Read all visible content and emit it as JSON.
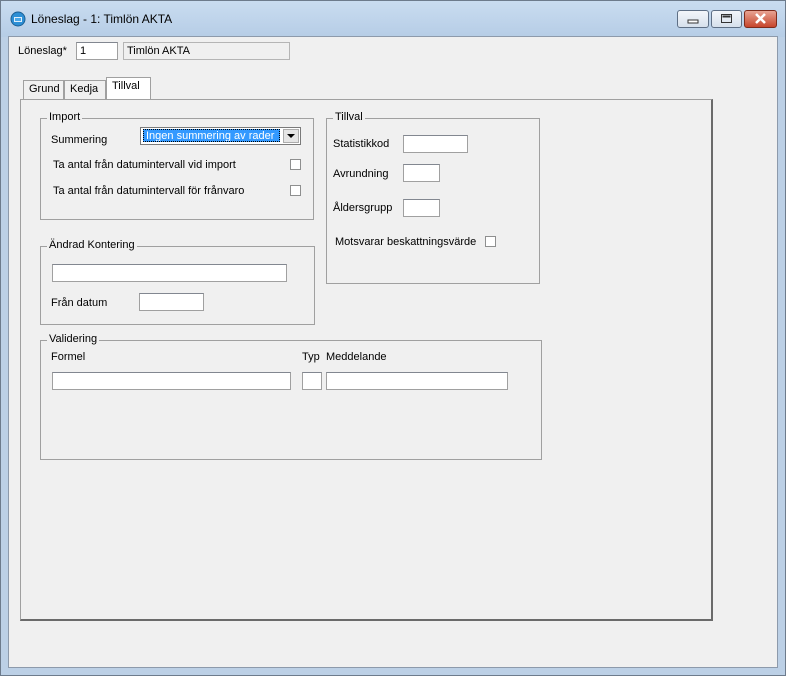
{
  "window": {
    "title": "Löneslag - 1: Timlön AKTA",
    "icon": "app-icon",
    "controls": [
      "minimize-icon",
      "maximize-icon",
      "close-icon"
    ]
  },
  "header": {
    "loneslag_label": "Löneslag*",
    "loneslag_value": "1",
    "name_value": "Timlön AKTA"
  },
  "tabs": [
    {
      "label": "Grund",
      "active": false
    },
    {
      "label": "Kedja",
      "active": false
    },
    {
      "label": "Tillval",
      "active": true
    }
  ],
  "import_group": {
    "legend": "Import",
    "summering_label": "Summering",
    "summering_value": "Ingen summering av rader",
    "checkbox1_label": "Ta antal från datumintervall vid import",
    "checkbox1_checked": false,
    "checkbox2_label": "Ta antal från datumintervall för frånvaro",
    "checkbox2_checked": false
  },
  "tillval_group": {
    "legend": "Tillval",
    "statistikkod_label": "Statistikkod",
    "statistikkod_value": "",
    "avrundning_label": "Avrundning",
    "avrundning_value": "",
    "aldersgrupp_label": "Åldersgrupp",
    "aldersgrupp_value": "",
    "beskattning_label": "Motsvarar beskattningsvärde",
    "beskattning_checked": false
  },
  "kontering_group": {
    "legend": "Ändrad Kontering",
    "kontering_value": "",
    "fran_datum_label": "Från datum",
    "fran_datum_value": ""
  },
  "validering_group": {
    "legend": "Validering",
    "formel_label": "Formel",
    "typ_label": "Typ",
    "meddelande_label": "Meddelande",
    "formel_value": "",
    "typ_value": "",
    "meddelande_value": ""
  }
}
